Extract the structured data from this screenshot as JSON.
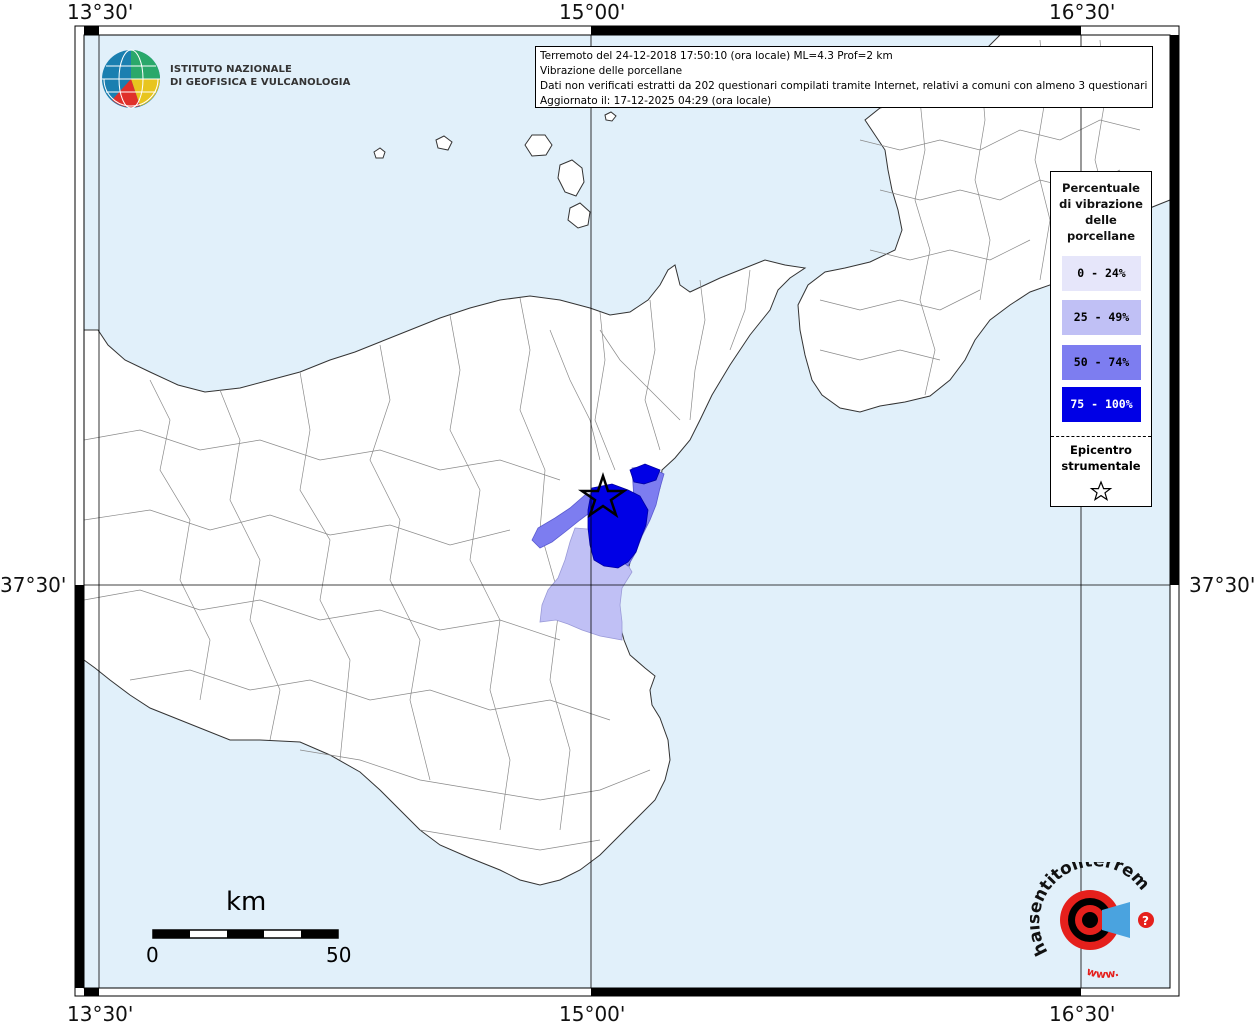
{
  "axes": {
    "top_ticks": [
      "13°30'",
      "15°00'",
      "16°30'"
    ],
    "bottom_ticks": [
      "13°30'",
      "15°00'",
      "16°30'"
    ],
    "left_tick": "37°30'",
    "right_tick": "37°30'"
  },
  "logo_ingv": {
    "line1": "ISTITUTO NAZIONALE",
    "line2": "DI GEOFISICA E VULCANOLOGIA"
  },
  "info": {
    "line1": "Terremoto del 24-12-2018 17:50:10 (ora locale) ML=4.3 Prof=2 km",
    "line2": "Vibrazione delle porcellane",
    "line3": "Dati non verificati estratti da 202 questionari compilati tramite Internet, relativi a comuni con almeno 3 questionari.",
    "line4": "Aggiornato il: 17-12-2025 04:29 (ora locale)"
  },
  "legend": {
    "title_lines": [
      "Percentuale",
      "di vibrazione",
      "delle",
      "porcellane"
    ],
    "items": [
      {
        "label": "0 - 24%",
        "color": "#e6e6fa",
        "text_color": "#000000"
      },
      {
        "label": "25 - 49%",
        "color": "#c0c0f5",
        "text_color": "#000000"
      },
      {
        "label": "50 - 74%",
        "color": "#7d7df0",
        "text_color": "#000000"
      },
      {
        "label": "75 - 100%",
        "color": "#0000e6",
        "text_color": "#ffffff"
      }
    ],
    "epicenter_lines": [
      "Epicentro",
      "strumentale"
    ]
  },
  "scale_bar": {
    "unit": "km",
    "min_label": "0",
    "max_label": "50"
  },
  "logo_hst": {
    "text": "haisentitoilterremoto.it",
    "prefix": "www."
  },
  "colors": {
    "sea": "#e1f0fa",
    "land": "#ffffff",
    "boundary": "#8a8a8a"
  }
}
